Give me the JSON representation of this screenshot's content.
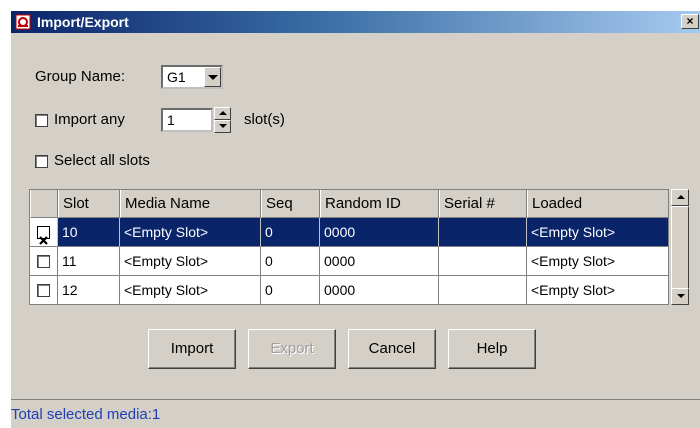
{
  "window": {
    "title": "Import/Export",
    "close_glyph": "×"
  },
  "group": {
    "label": "Group Name:",
    "value": "G1"
  },
  "import_any": {
    "label": "Import any",
    "checked": false,
    "value": "1",
    "suffix": "slot(s)"
  },
  "select_all": {
    "label": "Select all slots",
    "checked": false
  },
  "table": {
    "columns": [
      "Slot",
      "Media Name",
      "Seq",
      "Random ID",
      "Serial #",
      "Loaded"
    ],
    "rows": [
      {
        "checked": true,
        "selected": true,
        "slot": "10",
        "media_name": "<Empty Slot>",
        "seq": "0",
        "random_id": "0000",
        "serial": "",
        "loaded": "<Empty Slot>"
      },
      {
        "checked": false,
        "selected": false,
        "slot": "11",
        "media_name": "<Empty Slot>",
        "seq": "0",
        "random_id": "0000",
        "serial": "",
        "loaded": "<Empty Slot>"
      },
      {
        "checked": false,
        "selected": false,
        "slot": "12",
        "media_name": "<Empty Slot>",
        "seq": "0",
        "random_id": "0000",
        "serial": "",
        "loaded": "<Empty Slot>"
      }
    ]
  },
  "buttons": {
    "import": "Import",
    "export": "Export",
    "cancel": "Cancel",
    "help": "Help"
  },
  "status": {
    "text": "Total selected media:1"
  },
  "colors": {
    "title_bar": "#0a246a",
    "face": "#d4d0c8",
    "selection": "#0a246a",
    "status_text": "#1f3fb4"
  }
}
